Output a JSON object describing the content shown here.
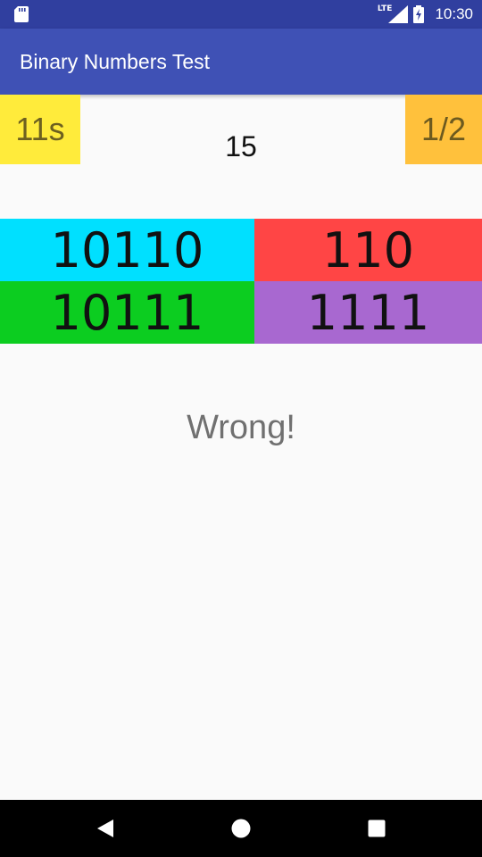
{
  "status_bar": {
    "network_label": "LTE",
    "time": "10:30"
  },
  "app_bar": {
    "title": "Binary Numbers Test"
  },
  "game": {
    "timer": "11s",
    "progress": "1/2",
    "target_number": "15",
    "options": [
      {
        "label": "10110",
        "color": "#00e0ff"
      },
      {
        "label": "110",
        "color": "#ff4545"
      },
      {
        "label": "10111",
        "color": "#0ccd20"
      },
      {
        "label": "1111",
        "color": "#a868d0"
      }
    ],
    "result_text": "Wrong!"
  },
  "nav_bar": {
    "icons": [
      "back-icon",
      "home-icon",
      "recents-icon"
    ]
  }
}
